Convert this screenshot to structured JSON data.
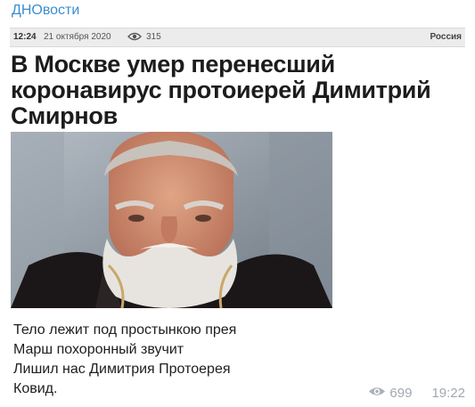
{
  "channel": {
    "title": "ДНОвости"
  },
  "meta": {
    "time": "12:24",
    "date": "21 октября 2020",
    "views": "315",
    "region": "Россия"
  },
  "headline": "В Москве умер перенесший коронавирус протоиерей Димитрий Смирнов",
  "caption": {
    "lines": [
      "Тело лежит под простынкою прея",
      "Марш похоронный звучит",
      "Лишил нас Димитрия Протоерея",
      "Ковид."
    ]
  },
  "footer": {
    "views": "699",
    "time": "19:22"
  },
  "icons": {
    "meta_views": "eye-icon",
    "footer_views": "eye-icon"
  }
}
